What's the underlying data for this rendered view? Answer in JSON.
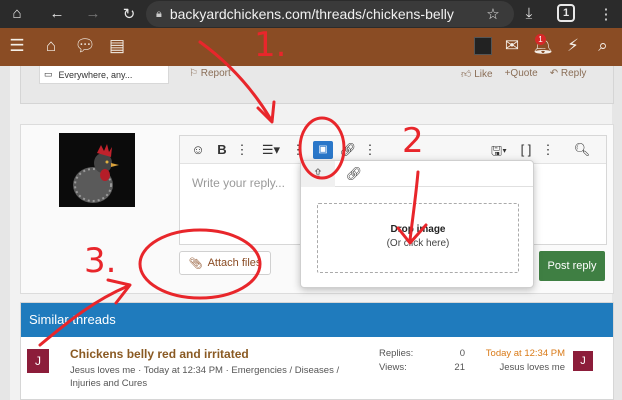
{
  "browser": {
    "url": "backyardchickens.com/threads/chickens-belly",
    "tab_count": "1",
    "icons": [
      "home-icon",
      "back-icon",
      "forward-icon",
      "reload-icon",
      "lock-icon",
      "star-icon",
      "download-icon",
      "tabs-icon",
      "menu-icon"
    ]
  },
  "site_nav": {
    "notification_count": "1",
    "icons": [
      "hamburger-icon",
      "home-icon",
      "chat-icon",
      "document-icon",
      "mail-icon",
      "bell-icon",
      "bolt-icon",
      "search-icon"
    ]
  },
  "post": {
    "location": "Everywhere, any...",
    "report_label": "Report",
    "like_label": "Like",
    "quote_label": "+Quote",
    "reply_label": "Reply"
  },
  "editor": {
    "placeholder": "Write your reply...",
    "attach_label": "Attach files",
    "post_reply_label": "Post reply"
  },
  "image_popup": {
    "drop_title": "Drop image",
    "drop_sub": "(Or click here)"
  },
  "similar": {
    "heading": "Similar threads",
    "threads": [
      {
        "avatar_letter": "J",
        "title": "Chickens belly red and irritated",
        "meta": "Jesus loves me · Today at 12:34 PM · Emergencies / Diseases / Injuries and Cures",
        "replies_label": "Replies:",
        "replies": "0",
        "views_label": "Views:",
        "views": "21",
        "latest_date": "Today at 12:34 PM",
        "latest_user": "Jesus loves me"
      }
    ]
  },
  "annotations": [
    "1.",
    "2",
    "3."
  ],
  "colors": {
    "nav": "#8a4c24",
    "similar_header": "#1f7bbd",
    "post_button": "#3f7f43",
    "annotation": "#e8262b"
  }
}
